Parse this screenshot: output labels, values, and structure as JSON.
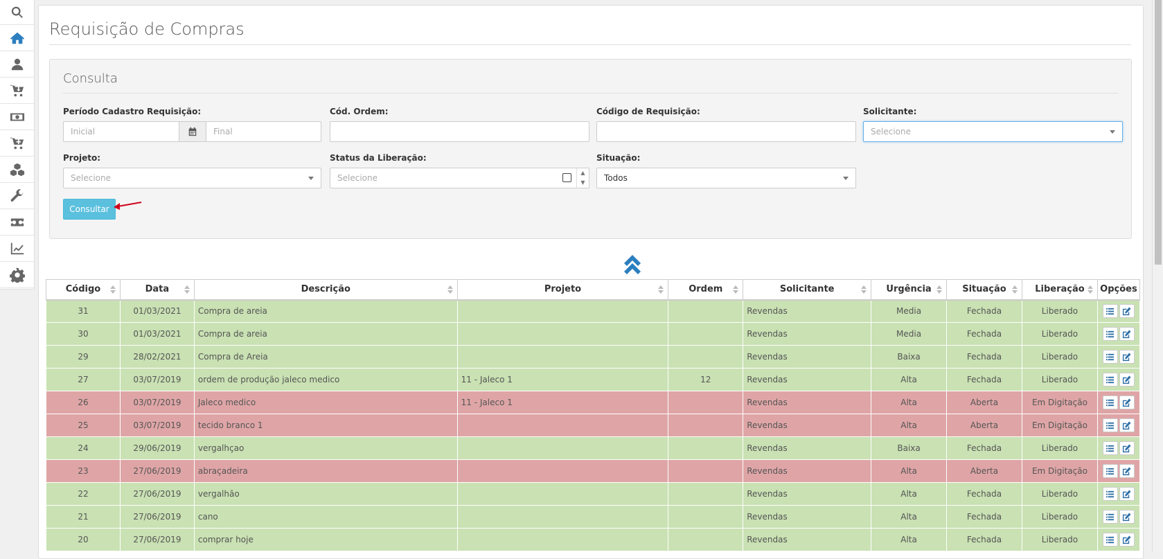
{
  "sidebar": {
    "items": [
      {
        "icon": "search-icon"
      },
      {
        "icon": "home-icon"
      },
      {
        "icon": "user-icon"
      },
      {
        "icon": "cart-download-icon"
      },
      {
        "icon": "money-icon"
      },
      {
        "icon": "cart-plus-icon"
      },
      {
        "icon": "cubes-icon"
      },
      {
        "icon": "wrench-icon"
      },
      {
        "icon": "ticket-icon"
      },
      {
        "icon": "line-chart-icon"
      },
      {
        "icon": "gear-icon"
      }
    ]
  },
  "page": {
    "title": "Requisição de Compras"
  },
  "consulta": {
    "title": "Consulta",
    "periodo_label": "Período Cadastro Requisição:",
    "inicial_placeholder": "Inicial",
    "final_placeholder": "Final",
    "cod_ordem_label": "Cód. Ordem:",
    "cod_requisicao_label": "Código de Requisição:",
    "solicitante_label": "Solicitante:",
    "solicitante_value": "Selecione",
    "projeto_label": "Projeto:",
    "projeto_value": "Selecione",
    "status_label": "Status da Liberação:",
    "status_value": "Selecione",
    "situacao_label": "Situação:",
    "situacao_value": "Todos",
    "consultar_label": "Consultar"
  },
  "table": {
    "headers": [
      "Código",
      "Data",
      "Descrição",
      "Projeto",
      "Ordem",
      "Solicitante",
      "Urgência",
      "Situação",
      "Liberação",
      "Opções"
    ],
    "rows": [
      {
        "status": "green",
        "cells": [
          "31",
          "01/03/2021",
          "Compra de areia",
          "",
          "",
          "Revendas",
          "Media",
          "Fechada",
          "Liberado"
        ]
      },
      {
        "status": "green",
        "cells": [
          "30",
          "01/03/2021",
          "Compra de areia",
          "",
          "",
          "Revendas",
          "Media",
          "Fechada",
          "Liberado"
        ]
      },
      {
        "status": "green",
        "cells": [
          "29",
          "28/02/2021",
          "Compra de Areia",
          "",
          "",
          "Revendas",
          "Baixa",
          "Fechada",
          "Liberado"
        ]
      },
      {
        "status": "green",
        "cells": [
          "27",
          "03/07/2019",
          "ordem de produção jaleco medico",
          "11 - Jaleco 1",
          "12",
          "Revendas",
          "Alta",
          "Fechada",
          "Liberado"
        ]
      },
      {
        "status": "red",
        "cells": [
          "26",
          "03/07/2019",
          "Jaleco medico",
          "11 - Jaleco 1",
          "",
          "Revendas",
          "Alta",
          "Aberta",
          "Em Digitação"
        ]
      },
      {
        "status": "red",
        "cells": [
          "25",
          "03/07/2019",
          "tecido branco 1",
          "",
          "",
          "Revendas",
          "Alta",
          "Aberta",
          "Em Digitação"
        ]
      },
      {
        "status": "green",
        "cells": [
          "24",
          "29/06/2019",
          "vergalhçao",
          "",
          "",
          "Revendas",
          "Baixa",
          "Fechada",
          "Liberado"
        ]
      },
      {
        "status": "red",
        "cells": [
          "23",
          "27/06/2019",
          "abraçadeira",
          "",
          "",
          "Revendas",
          "Alta",
          "Aberta",
          "Em Digitação"
        ]
      },
      {
        "status": "green",
        "cells": [
          "22",
          "27/06/2019",
          "vergalhão",
          "",
          "",
          "Revendas",
          "Alta",
          "Fechada",
          "Liberado"
        ]
      },
      {
        "status": "green",
        "cells": [
          "21",
          "27/06/2019",
          "cano",
          "",
          "",
          "Revendas",
          "Alta",
          "Fechada",
          "Liberado"
        ]
      },
      {
        "status": "green",
        "cells": [
          "20",
          "27/06/2019",
          "comprar hoje",
          "",
          "",
          "Revendas",
          "Alta",
          "Fechada",
          "Liberado"
        ]
      }
    ]
  },
  "colors": {
    "row_green": "#c9e1b3",
    "row_red": "#dfa5a6",
    "accent": "#2c7fbf",
    "button": "#5bc0de"
  }
}
